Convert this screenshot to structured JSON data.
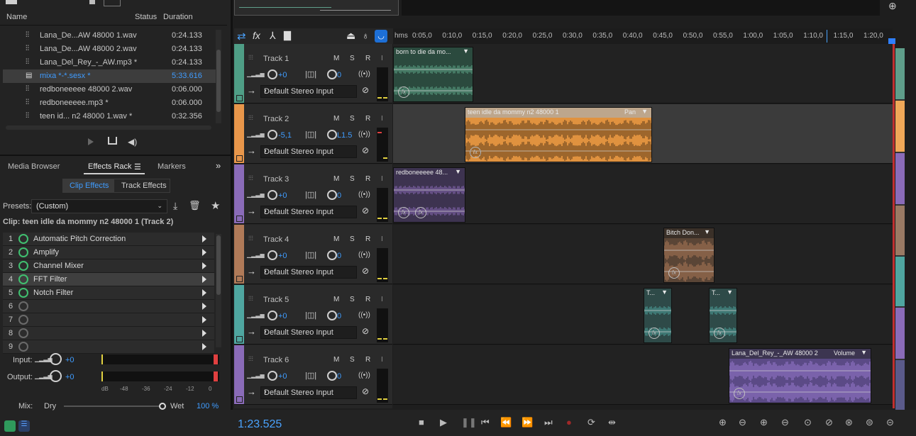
{
  "files": {
    "col_name": "Name",
    "col_status": "Status",
    "col_duration": "Duration",
    "rows": [
      {
        "name": "Lana_De...AW 48000 1.wav",
        "duration": "0:24.133",
        "icon": "waveform-icon"
      },
      {
        "name": "Lana_De...AW 48000 2.wav",
        "duration": "0:24.133",
        "icon": "waveform-icon"
      },
      {
        "name": "Lana_Del_Rey_-_AW.mp3 *",
        "duration": "0:24.133",
        "icon": "waveform-icon"
      },
      {
        "name": "mixa *-*.sesx *",
        "duration": "5:33.616",
        "icon": "multitrack-icon"
      },
      {
        "name": "redboneeeee 48000 2.wav",
        "duration": "0:06.000",
        "icon": "waveform-icon"
      },
      {
        "name": "redboneeeee.mp3 *",
        "duration": "0:06.000",
        "icon": "waveform-icon"
      },
      {
        "name": "teen id... n2 48000 1.wav *",
        "duration": "0:32.356",
        "icon": "waveform-icon"
      }
    ]
  },
  "panel_tabs": {
    "media": "Media Browser",
    "effects": "Effects Rack",
    "markers": "Markers"
  },
  "effects": {
    "clip_tab": "Clip Effects",
    "track_tab": "Track Effects",
    "presets_label": "Presets:",
    "preset_value": "(Custom)",
    "clip_label": "Clip: teen idle da mommy n2 48000 1 (Track 2)",
    "slots": [
      {
        "n": "1",
        "name": "Automatic Pitch Correction",
        "on": true
      },
      {
        "n": "2",
        "name": "Amplify",
        "on": true
      },
      {
        "n": "3",
        "name": "Channel Mixer",
        "on": true
      },
      {
        "n": "4",
        "name": "FFT Filter",
        "on": true
      },
      {
        "n": "5",
        "name": "Notch Filter",
        "on": true
      },
      {
        "n": "6",
        "name": "",
        "on": false
      },
      {
        "n": "7",
        "name": "",
        "on": false
      },
      {
        "n": "8",
        "name": "",
        "on": false
      },
      {
        "n": "9",
        "name": "",
        "on": false
      }
    ],
    "input_label": "Input:",
    "input_value": "+0",
    "output_label": "Output:",
    "output_value": "+0",
    "db_scale": [
      "dB",
      "-48",
      "-36",
      "-24",
      "-12",
      "0"
    ],
    "mix_label": "Mix:",
    "dry": "Dry",
    "wet": "Wet",
    "wet_pct": "100 %"
  },
  "ruler": {
    "start": "hms",
    "ticks": [
      "0:05,0",
      "0:10,0",
      "0:15,0",
      "0:20,0",
      "0:25,0",
      "0:30,0",
      "0:35,0",
      "0:40,0",
      "0:45,0",
      "0:50,0",
      "0:55,0",
      "1:00,0",
      "1:05,0",
      "1:10,0",
      "1:15,0",
      "1:20,0"
    ]
  },
  "track_common": {
    "m": "M",
    "s": "S",
    "r": "R",
    "i": "I",
    "input": "Default Stereo Input"
  },
  "tracks": [
    {
      "name": "Track 1",
      "vol": "+0",
      "pan": "0",
      "color": "#4f9e86"
    },
    {
      "name": "Track 2",
      "vol": "-5,1",
      "pan": "L1.5",
      "color": "#e8964a"
    },
    {
      "name": "Track 3",
      "vol": "+0",
      "pan": "0",
      "color": "#8a6bb8"
    },
    {
      "name": "Track 4",
      "vol": "+0",
      "pan": "0",
      "color": "#b07a58"
    },
    {
      "name": "Track 5",
      "vol": "+0",
      "pan": "0",
      "color": "#4fa6a0"
    },
    {
      "name": "Track 6",
      "vol": "+0",
      "pan": "0",
      "color": "#8a6bb8"
    }
  ],
  "clips": [
    {
      "name": "born to die da mo...",
      "extra": ""
    },
    {
      "name": "teen idle da mommy n2 48000 1",
      "extra": "Pan"
    },
    {
      "name": "redboneeeee 48...",
      "extra": ""
    },
    {
      "name": "Bitch Don...",
      "extra": ""
    },
    {
      "name": "T...",
      "extra": ""
    },
    {
      "name": "T...",
      "extra": ""
    },
    {
      "name": "Lana_Del_Rey_-_AW 48000 2",
      "extra": "Volume"
    }
  ],
  "transport": {
    "time": "1:23.525"
  }
}
